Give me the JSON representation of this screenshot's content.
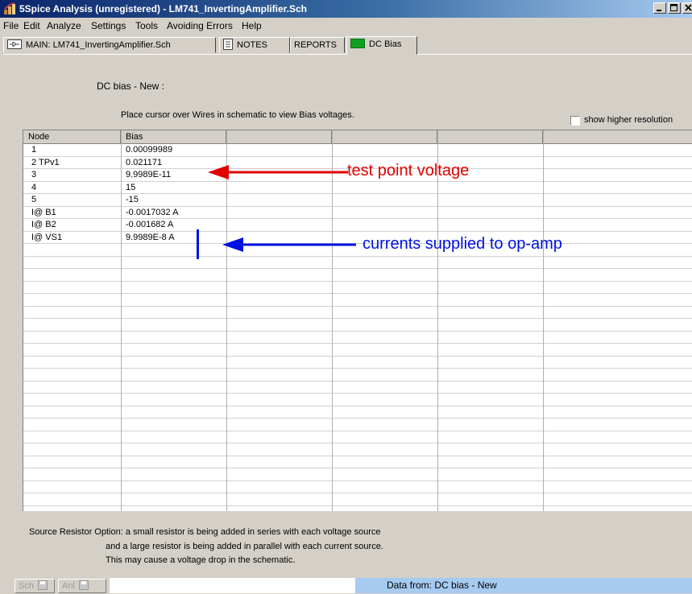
{
  "window": {
    "title": "5Spice Analysis (unregistered) - LM741_InvertingAmplifier.Sch"
  },
  "menu": [
    "File",
    "Edit",
    "Analyze",
    "Settings",
    "Tools",
    "Avoiding Errors",
    "Help"
  ],
  "tabs": [
    {
      "label": "MAIN:  LM741_InvertingAmplifier.Sch",
      "icon": "schematic-icon"
    },
    {
      "label": "NOTES",
      "icon": "notes-icon"
    },
    {
      "label": "REPORTS",
      "icon": ""
    },
    {
      "label": "DC Bias",
      "icon": "green-panel-icon",
      "active": true
    }
  ],
  "analysis": {
    "name": "DC bias - New   :",
    "instruction": "Place cursor over Wires in schematic to view Bias voltages.",
    "resolution_checkbox_label": "show higher resolution",
    "resolution_checked": false
  },
  "table": {
    "columns": [
      "Node",
      "Bias"
    ],
    "rows": [
      {
        "node": "1",
        "bias": "0.00099989"
      },
      {
        "node": "2  TPv1",
        "bias": "0.021171"
      },
      {
        "node": "3",
        "bias": "9.9989E-11"
      },
      {
        "node": "4",
        "bias": "15"
      },
      {
        "node": "5",
        "bias": "-15"
      },
      {
        "node": "I@ B1",
        "bias": "-0.0017032  A"
      },
      {
        "node": "I@ B2",
        "bias": "-0.001682  A"
      },
      {
        "node": "I@ VS1",
        "bias": "9.9989E-8  A"
      }
    ]
  },
  "annotations": {
    "test_point": "test point voltage",
    "currents": "currents supplied to op-amp",
    "red": "#e00000",
    "blue": "#0010e0"
  },
  "notes": {
    "line1": "Source Resistor Option:  a small resistor is being added in series with each voltage source",
    "line2": "and a large resistor is being added in parallel with each current source.",
    "line3": "This may cause a voltage drop in the schematic."
  },
  "statusbar": {
    "sch_label": "Sch",
    "anl_label": "Anl",
    "data_from": "Data from:  DC bias - New"
  }
}
